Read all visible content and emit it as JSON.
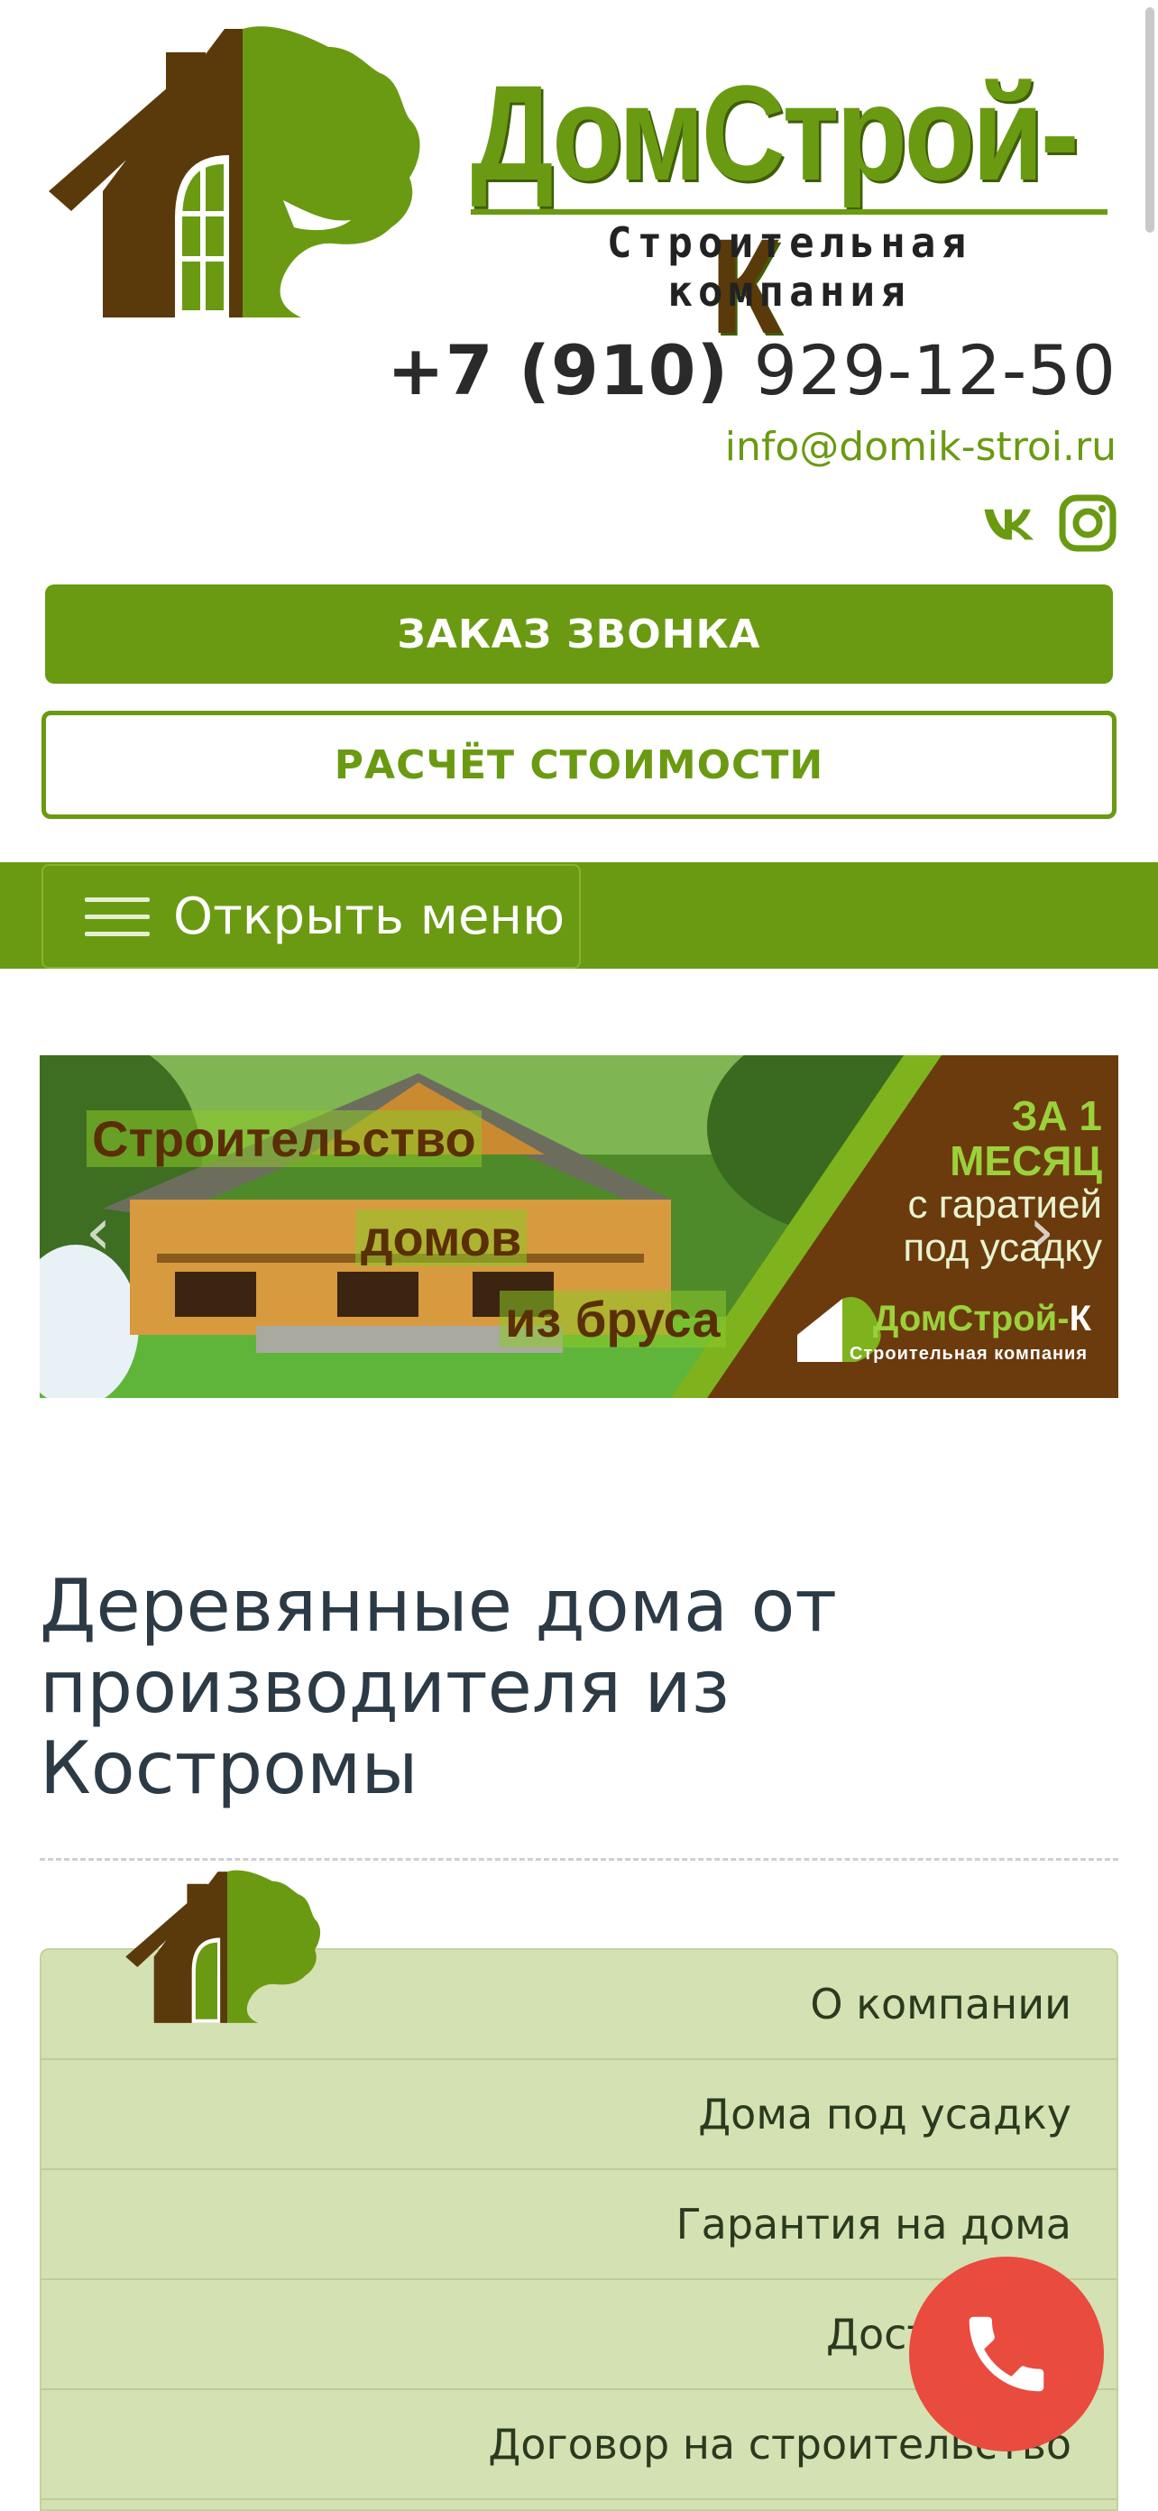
{
  "header": {
    "brand_name": "ДомСтрой-",
    "brand_letter": "К",
    "brand_subtitle": "Строительная компания",
    "phone_code": "+7 (910)",
    "phone_number": "929-12-50",
    "email": "info@domik-stroi.ru",
    "social": [
      "vk-icon",
      "instagram-icon"
    ]
  },
  "buttons": {
    "callback": "ЗАКАЗ ЗВОНКА",
    "calculate": "РАСЧЁТ СТОИМОСТИ"
  },
  "nav": {
    "toggle_label": "Открыть меню"
  },
  "banner": {
    "line1": "Строительство",
    "line2": "домов",
    "line3": "из бруса",
    "promo1": "ЗА 1 МЕСЯЦ",
    "promo2": "с гаратией",
    "promo3": "под усадку",
    "logo_name": "ДомСтрой-",
    "logo_letter": "К",
    "logo_sub": "Строительная компания",
    "prev": "‹",
    "next": "›"
  },
  "page": {
    "title": "Деревянные дома от производителя из Костромы"
  },
  "side_menu": {
    "items": [
      {
        "label": "О компании"
      },
      {
        "label": "Дома под усадку"
      },
      {
        "label": "Гарантия на дома"
      },
      {
        "label": "Доставка и"
      },
      {
        "label": "Договор на строительство"
      }
    ]
  },
  "colors": {
    "accent": "#6a9a12",
    "brown": "#5a3a0a",
    "menu_bg": "#d4e1b2",
    "fab": "#e94b3f"
  }
}
